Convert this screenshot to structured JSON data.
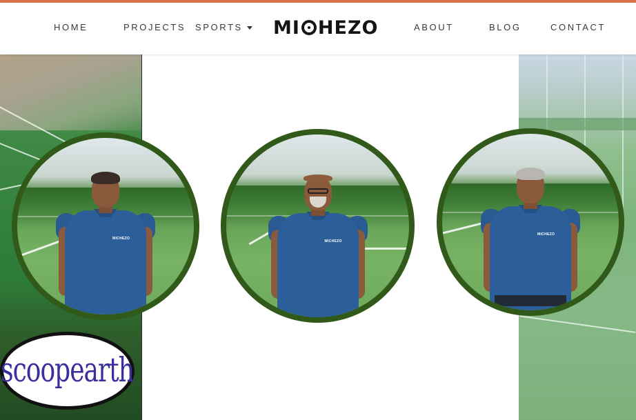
{
  "nav": {
    "home": "HOME",
    "projects": "PROJECTS",
    "sports": "SPORTS",
    "about": "ABOUT",
    "blog": "BLOG",
    "contact": "CONTACT"
  },
  "logo": {
    "left_text": "MI",
    "right_text": "HEZO"
  },
  "portraits": [
    {
      "shirt_badge": "MICHEZO"
    },
    {
      "shirt_badge": "MICHEZO"
    },
    {
      "shirt_badge": "MICHEZO"
    }
  ],
  "watermark": {
    "text": "scoopearth"
  },
  "colors": {
    "top_stripe": "#d9714f",
    "ring": "#315a1a",
    "shirt": "#2c5f99",
    "watermark_text": "#3b2f9e"
  },
  "icons": [
    "chevron-down-icon",
    "logo-ring-icon"
  ]
}
